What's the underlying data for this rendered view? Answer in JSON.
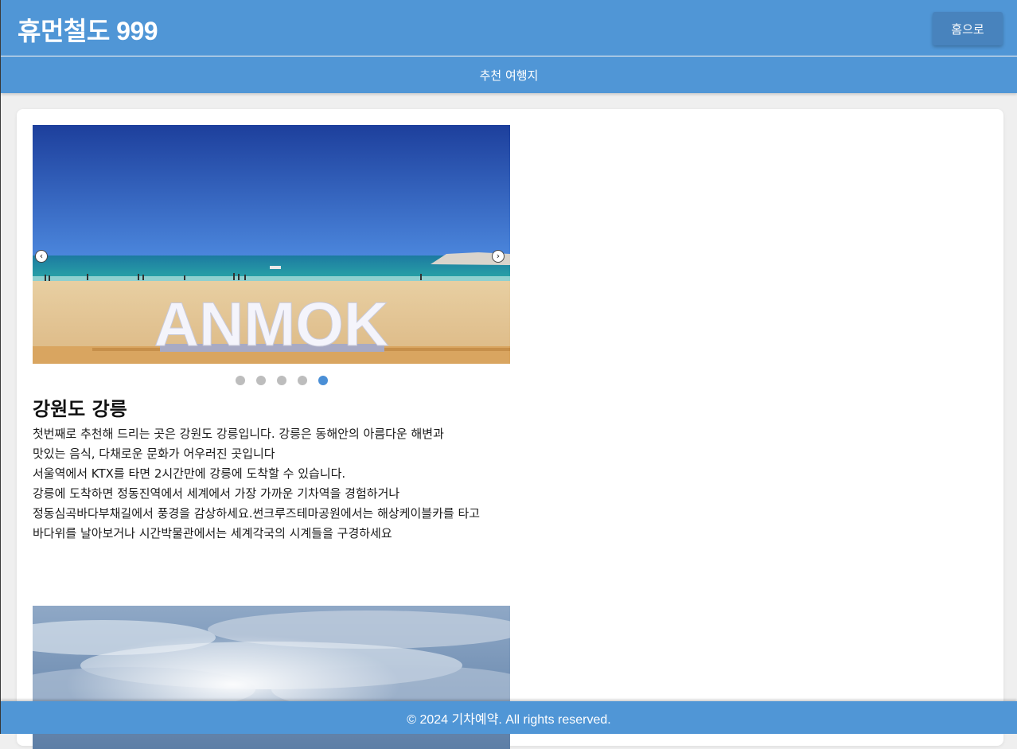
{
  "header": {
    "brand": "휴먼철도 999",
    "home_button": "홈으로"
  },
  "nav": {
    "recommended_link": "추천 여행지"
  },
  "slider": {
    "image_text": "ANMOK",
    "prev_icon": "chevron-left-icon",
    "next_icon": "chevron-right-icon",
    "dot_count": 5,
    "active_dot": 5
  },
  "destination": {
    "title": "강원도 강릉",
    "lines": [
      "첫번째로 추천해 드리는 곳은 강원도 강릉입니다. 강릉은 동해안의 아름다운 해변과",
      "맛있는 음식, 다채로운 문화가 어우러진 곳입니다",
      "서울역에서 KTX를 타면 2시간만에 강릉에 도착할 수 있습니다.",
      "강릉에 도착하면 정동진역에서 세계에서 가장 가까운 기차역을 경험하거나",
      "정동심곡바다부채길에서 풍경을 감상하세요.썬크루즈테마공원에서는 해상케이블카를 타고",
      "바다위를 날아보거나 시간박물관에서는 세계각국의 시계들을 구경하세요"
    ]
  },
  "footer": {
    "text": "© 2024 기차예약. All rights reserved."
  },
  "colors": {
    "primary": "#5096d6",
    "button": "#4883bd",
    "active_dot": "#4a8fd6",
    "inactive_dot": "#bdbdbd"
  }
}
